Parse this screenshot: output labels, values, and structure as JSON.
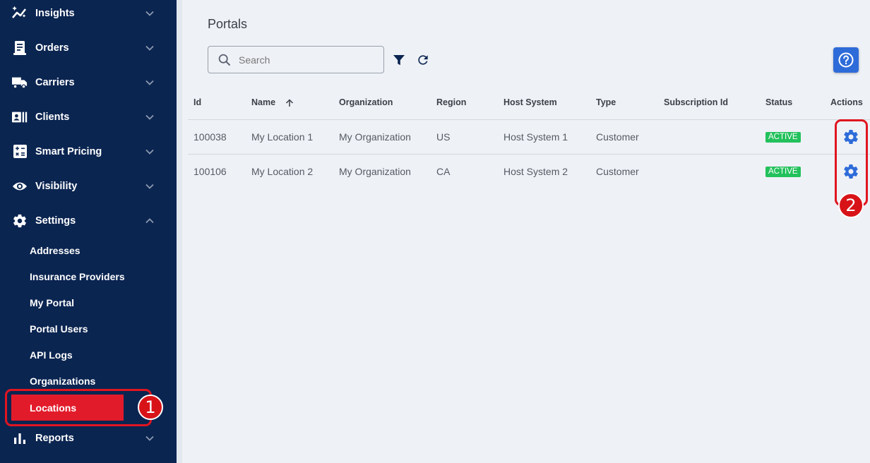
{
  "sidebar": {
    "nav": [
      {
        "label": "Insights",
        "icon": "insights-icon"
      },
      {
        "label": "Orders",
        "icon": "orders-icon"
      },
      {
        "label": "Carriers",
        "icon": "truck-icon"
      },
      {
        "label": "Clients",
        "icon": "clients-icon"
      },
      {
        "label": "Smart Pricing",
        "icon": "calculator-icon"
      },
      {
        "label": "Visibility",
        "icon": "eye-icon"
      },
      {
        "label": "Settings",
        "icon": "gear-icon"
      }
    ],
    "settings_sub": [
      "Addresses",
      "Insurance Providers",
      "My Portal",
      "Portal Users",
      "API Logs",
      "Organizations",
      "Locations"
    ],
    "reports": {
      "label": "Reports",
      "icon": "bar-chart-icon"
    }
  },
  "callouts": {
    "one": "1",
    "two": "2"
  },
  "main": {
    "title": "Portals",
    "search_placeholder": "Search",
    "columns": [
      "Id",
      "Name",
      "Organization",
      "Region",
      "Host System",
      "Type",
      "Subscription Id",
      "Status",
      "Actions"
    ],
    "rows": [
      {
        "id": "100038",
        "name": "My Location 1",
        "organization": "My Organization",
        "region": "US",
        "host": "Host System 1",
        "type": "Customer",
        "subscription": "",
        "status": "ACTIVE"
      },
      {
        "id": "100106",
        "name": "My Location 2",
        "organization": "My Organization",
        "region": "CA",
        "host": "Host System 2",
        "type": "Customer",
        "subscription": "",
        "status": "ACTIVE"
      }
    ]
  },
  "colors": {
    "sidebar": "#0b2551",
    "active": "#e21b2b",
    "callout": "#d81318",
    "primary": "#2d6bd9",
    "status_active": "#23c15c"
  }
}
